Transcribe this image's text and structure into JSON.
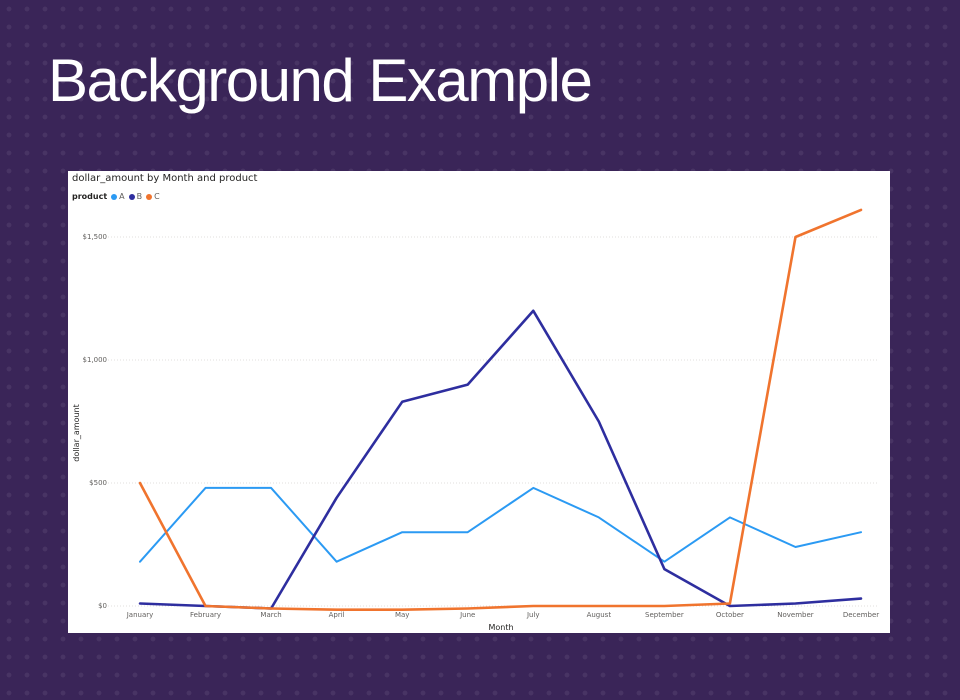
{
  "slide": {
    "title": "Background Example"
  },
  "chart_data": {
    "type": "line",
    "title": "dollar_amount by Month and product",
    "xlabel": "Month",
    "ylabel": "dollar_amount",
    "legend_title": "product",
    "legend_position": "top-left",
    "grid": true,
    "categories": [
      "January",
      "February",
      "March",
      "April",
      "May",
      "June",
      "July",
      "August",
      "September",
      "October",
      "November",
      "December"
    ],
    "ylim": [
      0,
      1600
    ],
    "yticks": [
      0,
      500,
      1000,
      1500
    ],
    "ytick_labels": [
      "$0",
      "$500",
      "$1,000",
      "$1,500"
    ],
    "series": [
      {
        "name": "A",
        "color": "#2b9af3",
        "values": [
          180,
          480,
          480,
          180,
          300,
          300,
          480,
          360,
          180,
          360,
          240,
          300
        ]
      },
      {
        "name": "B",
        "color": "#2e2e9f",
        "values": [
          10,
          0,
          -10,
          440,
          830,
          900,
          1200,
          750,
          150,
          0,
          10,
          30
        ]
      },
      {
        "name": "C",
        "color": "#f0742e",
        "values": [
          500,
          0,
          -10,
          -15,
          -15,
          -10,
          0,
          0,
          0,
          10,
          1500,
          1610
        ]
      }
    ]
  }
}
